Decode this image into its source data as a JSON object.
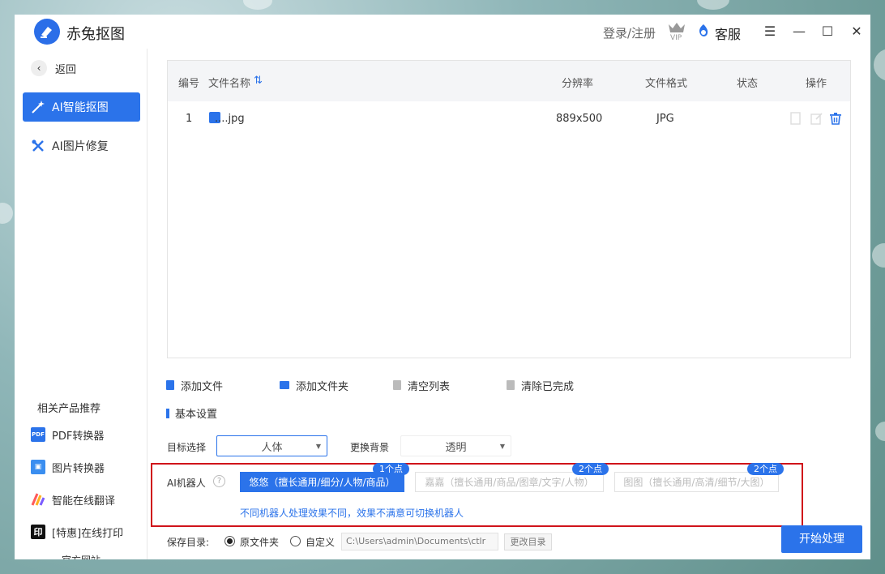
{
  "app": {
    "title": "赤兔抠图",
    "login_label": "登录/注册",
    "service_label": "客服"
  },
  "window_controls": {
    "menu": "☰",
    "minimize": "—",
    "maximize": "☐",
    "close": "✕"
  },
  "sidebar": {
    "back_label": "返回",
    "nav": [
      {
        "label": "AI智能抠图",
        "icon": "magic-wand-icon",
        "active": true
      },
      {
        "label": "AI图片修复",
        "icon": "tools-icon",
        "active": false
      }
    ],
    "related_title": "相关产品推荐",
    "products": [
      {
        "label": "PDF转换器",
        "icon": "pdf-icon",
        "icon_text": "PDF",
        "color": "#2b73ea"
      },
      {
        "label": "图片转换器",
        "icon": "image-converter-icon",
        "icon_text": "▣",
        "color": "#3a8ef0"
      },
      {
        "label": "智能在线翻译",
        "icon": "translate-icon",
        "icon_text": "",
        "color": "#ff5a5a"
      },
      {
        "label": "[特惠]在线打印",
        "icon": "print-icon",
        "icon_text": "印",
        "color": "#111111"
      }
    ],
    "official_site": "官方网站"
  },
  "table": {
    "headers": {
      "num": "编号",
      "name": "文件名称",
      "resolution": "分辨率",
      "format": "文件格式",
      "status": "状态",
      "action": "操作"
    },
    "rows": [
      {
        "num": "1",
        "name": "....jpg",
        "resolution": "889x500",
        "format": "JPG",
        "status": ""
      }
    ]
  },
  "toolbar": {
    "add_file": "添加文件",
    "add_folder": "添加文件夹",
    "clear_list": "清空列表",
    "clear_done": "清除已完成"
  },
  "settings": {
    "title": "基本设置",
    "target_label": "目标选择",
    "target_value": "人体",
    "bg_label": "更换背景",
    "bg_value": "透明",
    "robot_label": "AI机器人",
    "robots": [
      {
        "label": "悠悠（擅长通用/细分/人物/商品）",
        "badge": "1个点",
        "active": true
      },
      {
        "label": "嘉嘉（擅长通用/商品/图章/文字/人物）",
        "badge": "2个点",
        "active": false
      },
      {
        "label": "图图（擅长通用/高清/细节/大图）",
        "badge": "2个点",
        "active": false
      }
    ],
    "robot_tip": "不同机器人处理效果不同，效果不满意可切换机器人"
  },
  "save": {
    "label": "保存目录:",
    "option_original": "原文件夹",
    "option_custom": "自定义",
    "path": "C:\\Users\\admin\\Documents\\ctlr",
    "change_dir": "更改目录"
  },
  "start_button": "开始处理",
  "colors": {
    "accent": "#2b73ea",
    "highlight_frame": "#d0131a"
  }
}
